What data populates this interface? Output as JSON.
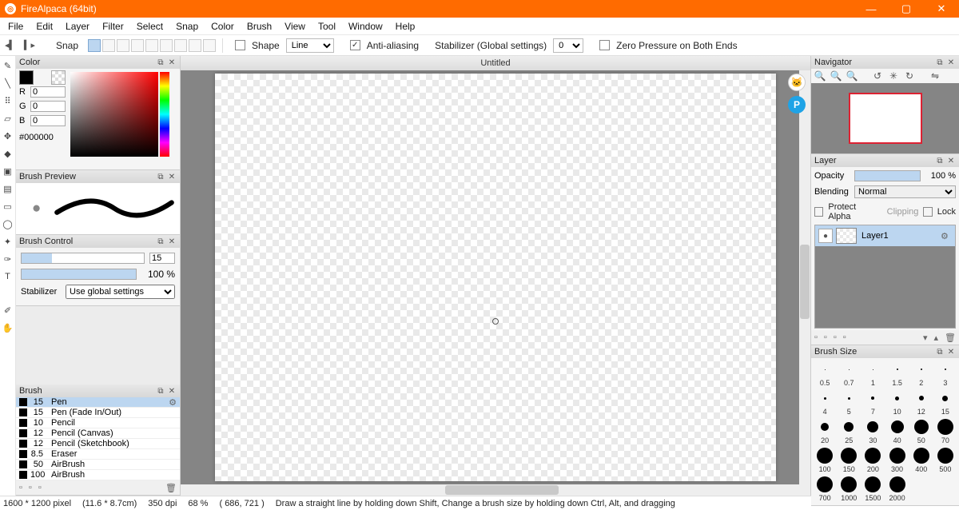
{
  "titlebar": {
    "title": "FireAlpaca (64bit)"
  },
  "menu": [
    "File",
    "Edit",
    "Layer",
    "Filter",
    "Select",
    "Snap",
    "Color",
    "Brush",
    "View",
    "Tool",
    "Window",
    "Help"
  ],
  "options": {
    "snap": "Snap",
    "shape_label": "Shape",
    "shape_value": "Line",
    "aa": "Anti-aliasing",
    "aa_checked": true,
    "stab_label": "Stabilizer (Global settings)",
    "stab_value": "0",
    "zero_pressure": "Zero Pressure on Both Ends",
    "zero_checked": false
  },
  "tabs": {
    "title": "Untitled"
  },
  "panels": {
    "color": {
      "title": "Color",
      "r": "0",
      "g": "0",
      "b": "0",
      "hex": "#000000"
    },
    "brushpreview": {
      "title": "Brush Preview"
    },
    "brushcontrol": {
      "title": "Brush Control",
      "size_value": "15",
      "size_fill_pct": 25,
      "opacity_label": "100 %",
      "stab_label": "Stabilizer",
      "stab_select": "Use global settings"
    },
    "brush": {
      "title": "Brush",
      "items": [
        {
          "size": "15",
          "name": "Pen",
          "sel": true
        },
        {
          "size": "15",
          "name": "Pen (Fade In/Out)"
        },
        {
          "size": "10",
          "name": "Pencil"
        },
        {
          "size": "12",
          "name": "Pencil (Canvas)"
        },
        {
          "size": "12",
          "name": "Pencil (Sketchbook)"
        },
        {
          "size": "8.5",
          "name": "Eraser"
        },
        {
          "size": "50",
          "name": "AirBrush"
        },
        {
          "size": "100",
          "name": "AirBrush"
        }
      ]
    },
    "navigator": {
      "title": "Navigator"
    },
    "layer": {
      "title": "Layer",
      "opacity_label": "Opacity",
      "opacity_value": "100 %",
      "blending_label": "Blending",
      "blending_value": "Normal",
      "protect_alpha": "Protect Alpha",
      "clipping": "Clipping",
      "lock": "Lock",
      "layers": [
        {
          "name": "Layer1"
        }
      ]
    },
    "brushsize": {
      "title": "Brush Size",
      "rows": [
        [
          "0.5",
          "0.7",
          "1",
          "1.5",
          "2",
          "3"
        ],
        [
          "4",
          "5",
          "7",
          "10",
          "12",
          "15"
        ],
        [
          "20",
          "25",
          "30",
          "40",
          "50",
          "70"
        ],
        [
          "100",
          "150",
          "200",
          "300",
          "400",
          "500"
        ],
        [
          "700",
          "1000",
          "1500",
          "2000"
        ]
      ],
      "dotpx": [
        [
          1,
          1,
          1,
          2,
          2,
          2
        ],
        [
          3,
          3,
          4,
          5,
          6,
          7
        ],
        [
          10,
          12,
          14,
          16,
          18,
          20
        ],
        [
          20,
          20,
          20,
          20,
          20,
          20
        ],
        [
          20,
          20,
          20,
          20
        ]
      ]
    }
  },
  "status": {
    "dims": "1600 * 1200 pixel",
    "physical": "(11.6 * 8.7cm)",
    "dpi": "350 dpi",
    "zoom": "68 %",
    "cursor": "( 686, 721 )",
    "hint": "Draw a straight line by holding down Shift, Change a brush size by holding down Ctrl, Alt, and dragging"
  },
  "tools": [
    "brush",
    "pencil",
    "dotbrush",
    "eraser",
    "move",
    "fill",
    "bucket",
    "gradient",
    "select-rect",
    "select-lasso",
    "select-wand",
    "select-pen",
    "text",
    "eyedropper",
    "hand",
    "divider",
    "object",
    "canvas-rot"
  ]
}
